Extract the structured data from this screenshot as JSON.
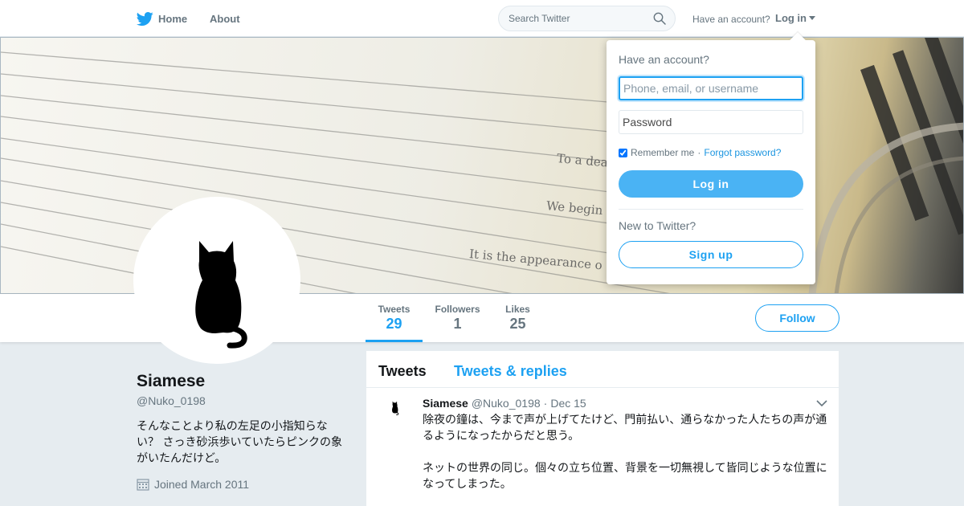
{
  "nav": {
    "home_label": "Home",
    "about_label": "About",
    "search_placeholder": "Search Twitter",
    "have_account_text": "Have an account?",
    "login_label": "Log in",
    "brand_color": "#1da1f2",
    "logo_icon": "twitter-bird-icon"
  },
  "banner": {
    "lines": [
      "To a dea",
      "We begin",
      "It is the appearance o"
    ]
  },
  "profile": {
    "name": "Siamese",
    "handle": "@Nuko_0198",
    "bio": "そんなことより私の左足の小指知らない？ さっき砂浜歩いていたらピンクの象がいたんだけど。",
    "joined": "Joined March 2011",
    "avatar_icon": "black-cat-silhouette-icon"
  },
  "stats": [
    {
      "label": "Tweets",
      "value": "29",
      "active": true
    },
    {
      "label": "Followers",
      "value": "1",
      "active": false
    },
    {
      "label": "Likes",
      "value": "25",
      "active": false
    }
  ],
  "follow_label": "Follow",
  "timeline": {
    "tabs": [
      {
        "label": "Tweets",
        "active": true
      },
      {
        "label": "Tweets & replies",
        "active": false
      }
    ],
    "tweets": [
      {
        "name": "Siamese",
        "handle": "@Nuko_0198",
        "separator": "·",
        "date": "Dec 15",
        "paragraphs": [
          "除夜の鐘は、今まで声が上げてたけど、門前払い、通らなかった人たちの声が通るようになったからだと思う。",
          "ネットの世界の同じ。個々の立ち位置、背景を一切無視して皆同じような位置になってしまった。"
        ]
      }
    ]
  },
  "login_dropdown": {
    "title": "Have an account?",
    "username_placeholder": "Phone, email, or username",
    "password_placeholder": "Password",
    "remember_label": "Remember me",
    "separator": "·",
    "forgot_label": "Forgot password?",
    "remember_checked": true,
    "login_button": "Log in",
    "new_text": "New to Twitter?",
    "signup_button": "Sign up"
  }
}
